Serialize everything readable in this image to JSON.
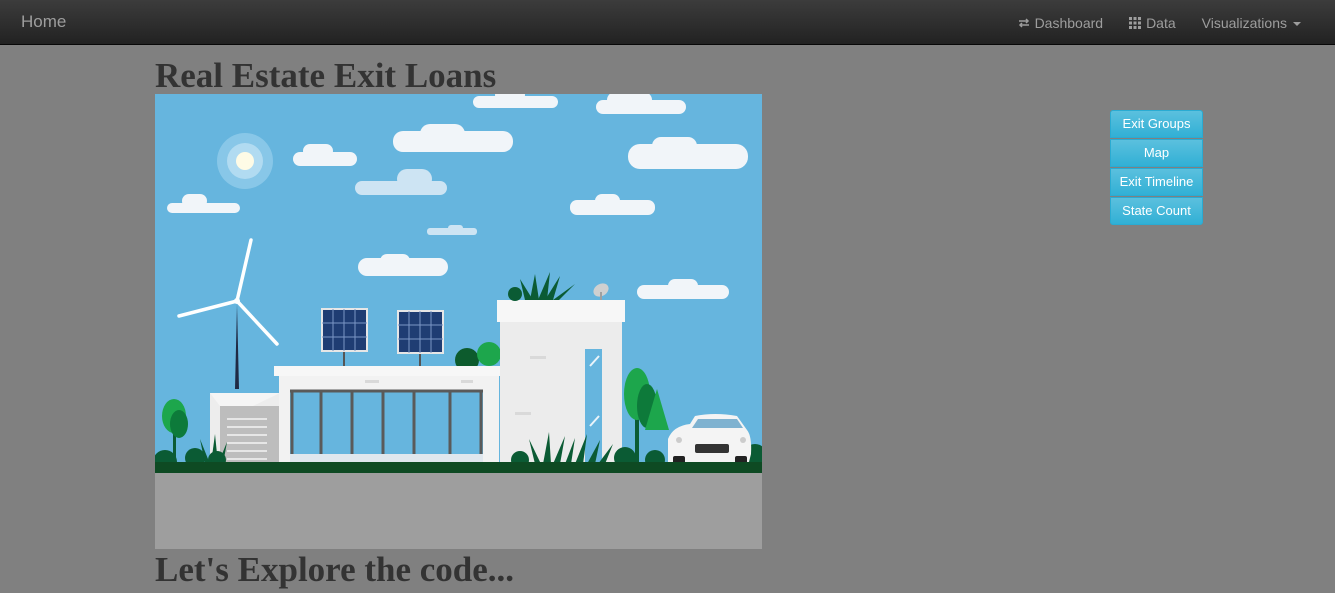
{
  "navbar": {
    "brand": "Home",
    "links": [
      {
        "label": "Dashboard",
        "icon": "transfer-icon"
      },
      {
        "label": "Data",
        "icon": "grid-icon"
      },
      {
        "label": "Visualizations",
        "icon": "caret-down-icon"
      }
    ]
  },
  "page": {
    "title": "Real Estate Exit Loans",
    "subtitle": "Let's Explore the code...",
    "hero_image": "house-illustration"
  },
  "viz_buttons": [
    "Exit Groups",
    "Map",
    "Exit Timeline",
    "State Count"
  ],
  "colors": {
    "navbar": "#222222",
    "background": "#808080",
    "button": "#5bc0de",
    "sky": "#66b5de",
    "ground": "#0e4a23"
  }
}
